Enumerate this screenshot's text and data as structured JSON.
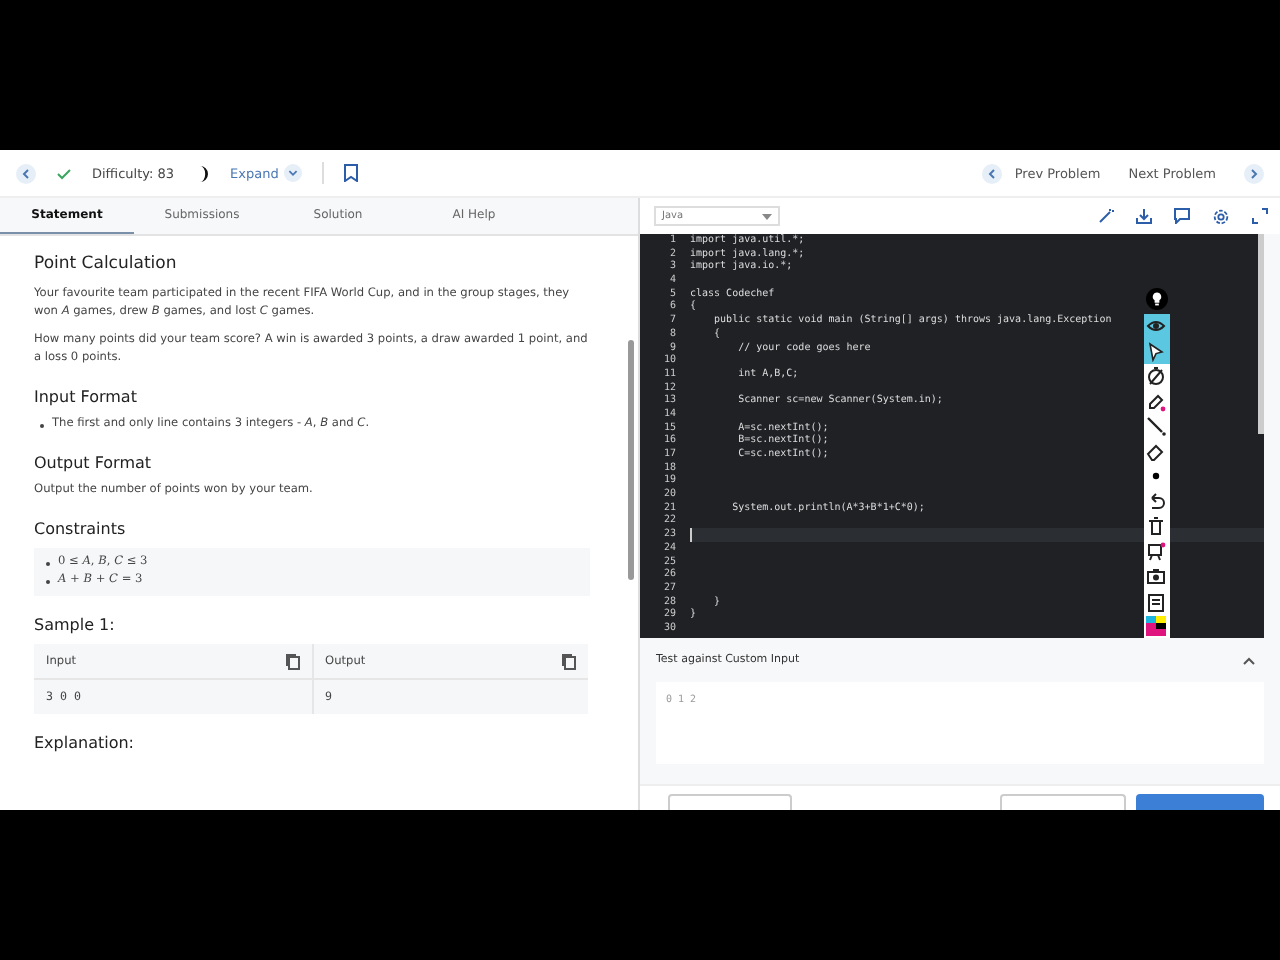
{
  "top_bar": {
    "difficulty": "Difficulty: 83",
    "expand": "Expand",
    "prev": "Prev Problem",
    "next": "Next Problem"
  },
  "tabs": [
    {
      "label": "Statement",
      "selected": true
    },
    {
      "label": "Submissions",
      "selected": false
    },
    {
      "label": "Solution",
      "selected": false
    },
    {
      "label": "AI Help",
      "selected": false
    }
  ],
  "problem": {
    "title": "Point Calculation",
    "paragraphs": [
      "Your favourite team participated in the recent FIFA World Cup, and in the group stages, they won *A* games, drew *B* games, and lost *C* games.",
      "How many points did your team score? A win is awarded 3 points, a draw awarded 1 point, and a loss 0 points."
    ],
    "input_heading": "Input Format",
    "input_items": [
      "The first and only line contains 3 integers - *A*, *B* and *C*."
    ],
    "output_heading": "Output Format",
    "output_text": "Output the number of points won by your team.",
    "constraints_heading": "Constraints",
    "constraints": [
      "0 ≤ *A*, *B*, *C* ≤ 3",
      "*A* + *B* + *C* = 3"
    ],
    "sample_heading": "Sample 1:",
    "sample": {
      "input_label": "Input",
      "output_label": "Output",
      "input": "3 0 0",
      "output": "9"
    },
    "explanation_heading": "Explanation:"
  },
  "editor": {
    "language": "Java",
    "lines": [
      {
        "number": "1",
        "text": "import java.util.*;",
        "current": false
      },
      {
        "number": "2",
        "text": "import java.lang.*;",
        "current": false
      },
      {
        "number": "3",
        "text": "import java.io.*;",
        "current": false
      },
      {
        "number": "4",
        "current": false
      },
      {
        "number": "5",
        "text": "class Codechef",
        "current": false
      },
      {
        "number": "6",
        "text": "{",
        "current": false
      },
      {
        "number": "7",
        "text": "    public static void main (String[] args) throws java.lang.Exception",
        "current": false
      },
      {
        "number": "8",
        "text": "    {",
        "current": false
      },
      {
        "number": "9",
        "text": "        // your code goes here",
        "current": false
      },
      {
        "number": "10",
        "current": false
      },
      {
        "number": "11",
        "text": "        int A,B,C;",
        "current": false
      },
      {
        "number": "12",
        "current": false
      },
      {
        "number": "13",
        "text": "        Scanner sc=new Scanner(System.in);",
        "current": false
      },
      {
        "number": "14",
        "current": false
      },
      {
        "number": "15",
        "text": "        A=sc.nextInt();",
        "current": false
      },
      {
        "number": "16",
        "text": "        B=sc.nextInt();",
        "current": false
      },
      {
        "number": "17",
        "text": "        C=sc.nextInt();",
        "current": false
      },
      {
        "number": "18",
        "current": false
      },
      {
        "number": "19",
        "current": false
      },
      {
        "number": "20",
        "current": false
      },
      {
        "number": "21",
        "text": "       System.out.println(A*3+B*1+C*0);",
        "current": false
      },
      {
        "number": "22",
        "current": false
      },
      {
        "number": "23",
        "current": true
      },
      {
        "number": "24",
        "current": false
      },
      {
        "number": "25",
        "current": false
      },
      {
        "number": "26",
        "current": false
      },
      {
        "number": "27",
        "current": false
      },
      {
        "number": "28",
        "text": "    }",
        "current": false
      },
      {
        "number": "29",
        "text": "}",
        "current": false
      },
      {
        "number": "30",
        "current": false
      }
    ]
  },
  "annotation_tools": [
    {
      "kind": "bulb",
      "selected": false
    },
    {
      "kind": "eye",
      "selected": true
    },
    {
      "kind": "cursor",
      "selected": true
    },
    {
      "kind": "timer",
      "selected": false
    },
    {
      "kind": "pen",
      "selected": false
    },
    {
      "kind": "line",
      "selected": false
    },
    {
      "kind": "eraser",
      "selected": false
    },
    {
      "kind": "dot",
      "selected": false
    },
    {
      "kind": "undo",
      "selected": false
    },
    {
      "kind": "trash",
      "selected": false
    },
    {
      "kind": "board",
      "selected": false
    },
    {
      "kind": "camera",
      "selected": false
    },
    {
      "kind": "clipboard",
      "selected": false
    },
    {
      "kind": "palette",
      "selected": false
    }
  ],
  "custom_input": {
    "title": "Test against Custom Input",
    "value": "0 1 2"
  }
}
